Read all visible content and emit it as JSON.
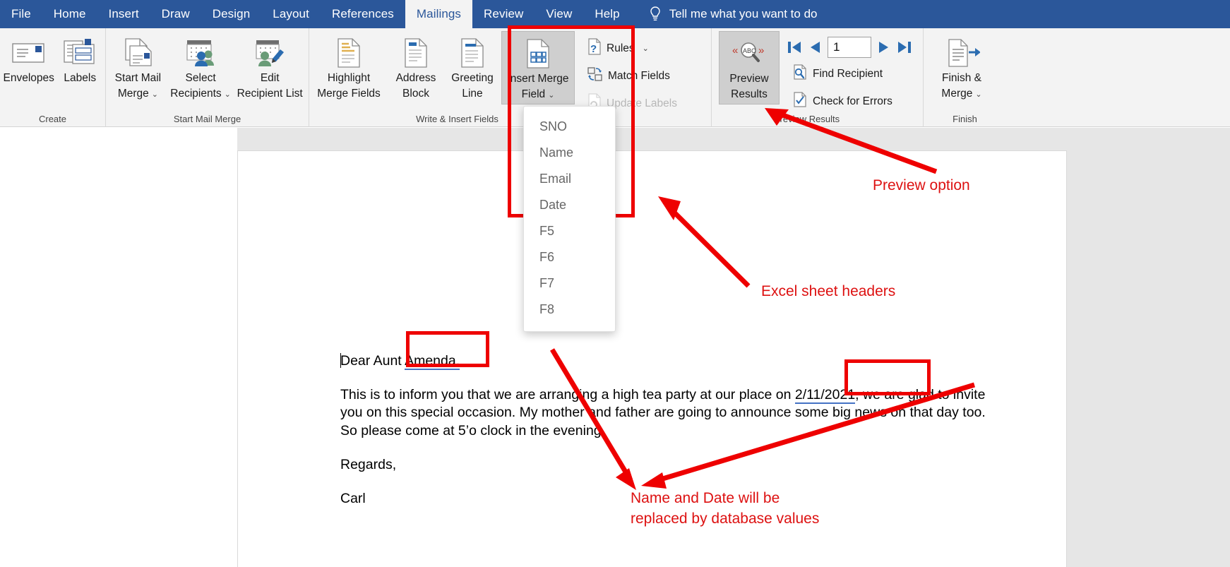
{
  "app": {
    "name": "Microsoft Word",
    "accent": "#2b579a",
    "annotation_color": "#dd1111"
  },
  "tabs": [
    {
      "label": "File",
      "active": false
    },
    {
      "label": "Home",
      "active": false
    },
    {
      "label": "Insert",
      "active": false
    },
    {
      "label": "Draw",
      "active": false
    },
    {
      "label": "Design",
      "active": false
    },
    {
      "label": "Layout",
      "active": false
    },
    {
      "label": "References",
      "active": false
    },
    {
      "label": "Mailings",
      "active": true
    },
    {
      "label": "Review",
      "active": false
    },
    {
      "label": "View",
      "active": false
    },
    {
      "label": "Help",
      "active": false
    }
  ],
  "tellme": {
    "label": "Tell me what you want to do",
    "icon": "lightbulb-icon"
  },
  "ribbon": {
    "groups": [
      {
        "name": "Create",
        "label": "Create",
        "buttons": [
          {
            "label": "Envelopes",
            "icon": "envelope-icon",
            "dropdown": false
          },
          {
            "label": "Labels",
            "icon": "labels-icon",
            "dropdown": false
          }
        ]
      },
      {
        "name": "Start Mail Merge",
        "label": "Start Mail Merge",
        "buttons": [
          {
            "label": "Start Mail\nMerge",
            "line1": "Start Mail",
            "line2": "Merge",
            "icon": "start-mail-merge-icon",
            "dropdown": true
          },
          {
            "label": "Select\nRecipients",
            "line1": "Select",
            "line2": "Recipients",
            "icon": "select-recipients-icon",
            "dropdown": true
          },
          {
            "label": "Edit\nRecipient List",
            "line1": "Edit",
            "line2": "Recipient List",
            "icon": "edit-recipient-list-icon",
            "dropdown": false
          }
        ]
      },
      {
        "name": "Write & Insert Fields",
        "label": "Write & Insert Fields",
        "buttons": [
          {
            "label": "Highlight\nMerge Fields",
            "line1": "Highlight",
            "line2": "Merge Fields",
            "icon": "highlight-merge-fields-icon",
            "dropdown": false
          },
          {
            "label": "Address\nBlock",
            "line1": "Address",
            "line2": "Block",
            "icon": "address-block-icon",
            "dropdown": false
          },
          {
            "label": "Greeting\nLine",
            "line1": "Greeting",
            "line2": "Line",
            "icon": "greeting-line-icon",
            "dropdown": false
          },
          {
            "label": "Insert Merge\nField",
            "line1": "Insert Merge",
            "line2": "Field",
            "icon": "insert-merge-field-icon",
            "dropdown": true,
            "selected": true
          }
        ],
        "small_buttons": [
          {
            "label": "Rules",
            "icon": "rules-icon",
            "dropdown": true,
            "disabled": false
          },
          {
            "label": "Match Fields",
            "icon": "match-fields-icon",
            "dropdown": false,
            "disabled": false
          },
          {
            "label": "Update Labels",
            "icon": "update-labels-icon",
            "dropdown": false,
            "disabled": true
          }
        ]
      },
      {
        "name": "Preview Results",
        "label": "Preview Results",
        "buttons": [
          {
            "label": "Preview\nResults",
            "line1": "Preview",
            "line2": "Results",
            "icon": "preview-results-icon",
            "dropdown": false,
            "selected": true
          }
        ],
        "nav": {
          "first_label": "First Record",
          "prev_label": "Previous Record",
          "next_label": "Next Record",
          "last_label": "Last Record",
          "record_value": "1"
        },
        "small_buttons": [
          {
            "label": "Find Recipient",
            "icon": "find-recipient-icon",
            "disabled": false
          },
          {
            "label": "Check for Errors",
            "icon": "check-for-errors-icon",
            "disabled": false
          }
        ]
      },
      {
        "name": "Finish",
        "label": "Finish",
        "buttons": [
          {
            "label": "Finish &\nMerge",
            "line1": "Finish &",
            "line2": "Merge",
            "icon": "finish-and-merge-icon",
            "dropdown": true
          }
        ]
      }
    ]
  },
  "dropdown_menu": {
    "name": "insert-merge-field-menu",
    "items": [
      {
        "label": "SNO"
      },
      {
        "label": "Name"
      },
      {
        "label": "Email"
      },
      {
        "label": "Date"
      },
      {
        "label": "F5"
      },
      {
        "label": "F6"
      },
      {
        "label": "F7"
      },
      {
        "label": "F8"
      }
    ]
  },
  "document": {
    "salutation_prefix": "Dear Aunt",
    "salutation_field": "Amenda,",
    "body_before_date": "This is to inform you that we are arranging a high tea party at our place on ",
    "body_date_field": "2/11/2021",
    "body_after_date": ", we are glad to invite you on this special occasion. My mother and father are going to announce some big news on that day too. So please come at 5’o clock in the evening.",
    "closing": "Regards,",
    "signature": "Carl"
  },
  "annotations": [
    {
      "name": "preview-option-annotation",
      "text": "Preview option"
    },
    {
      "name": "excel-sheet-headers-annotation",
      "text": "Excel sheet headers"
    },
    {
      "name": "replace-note-annotation-line1",
      "text": "Name and Date will be"
    },
    {
      "name": "replace-note-annotation-line2",
      "text": "replaced by database values"
    }
  ]
}
